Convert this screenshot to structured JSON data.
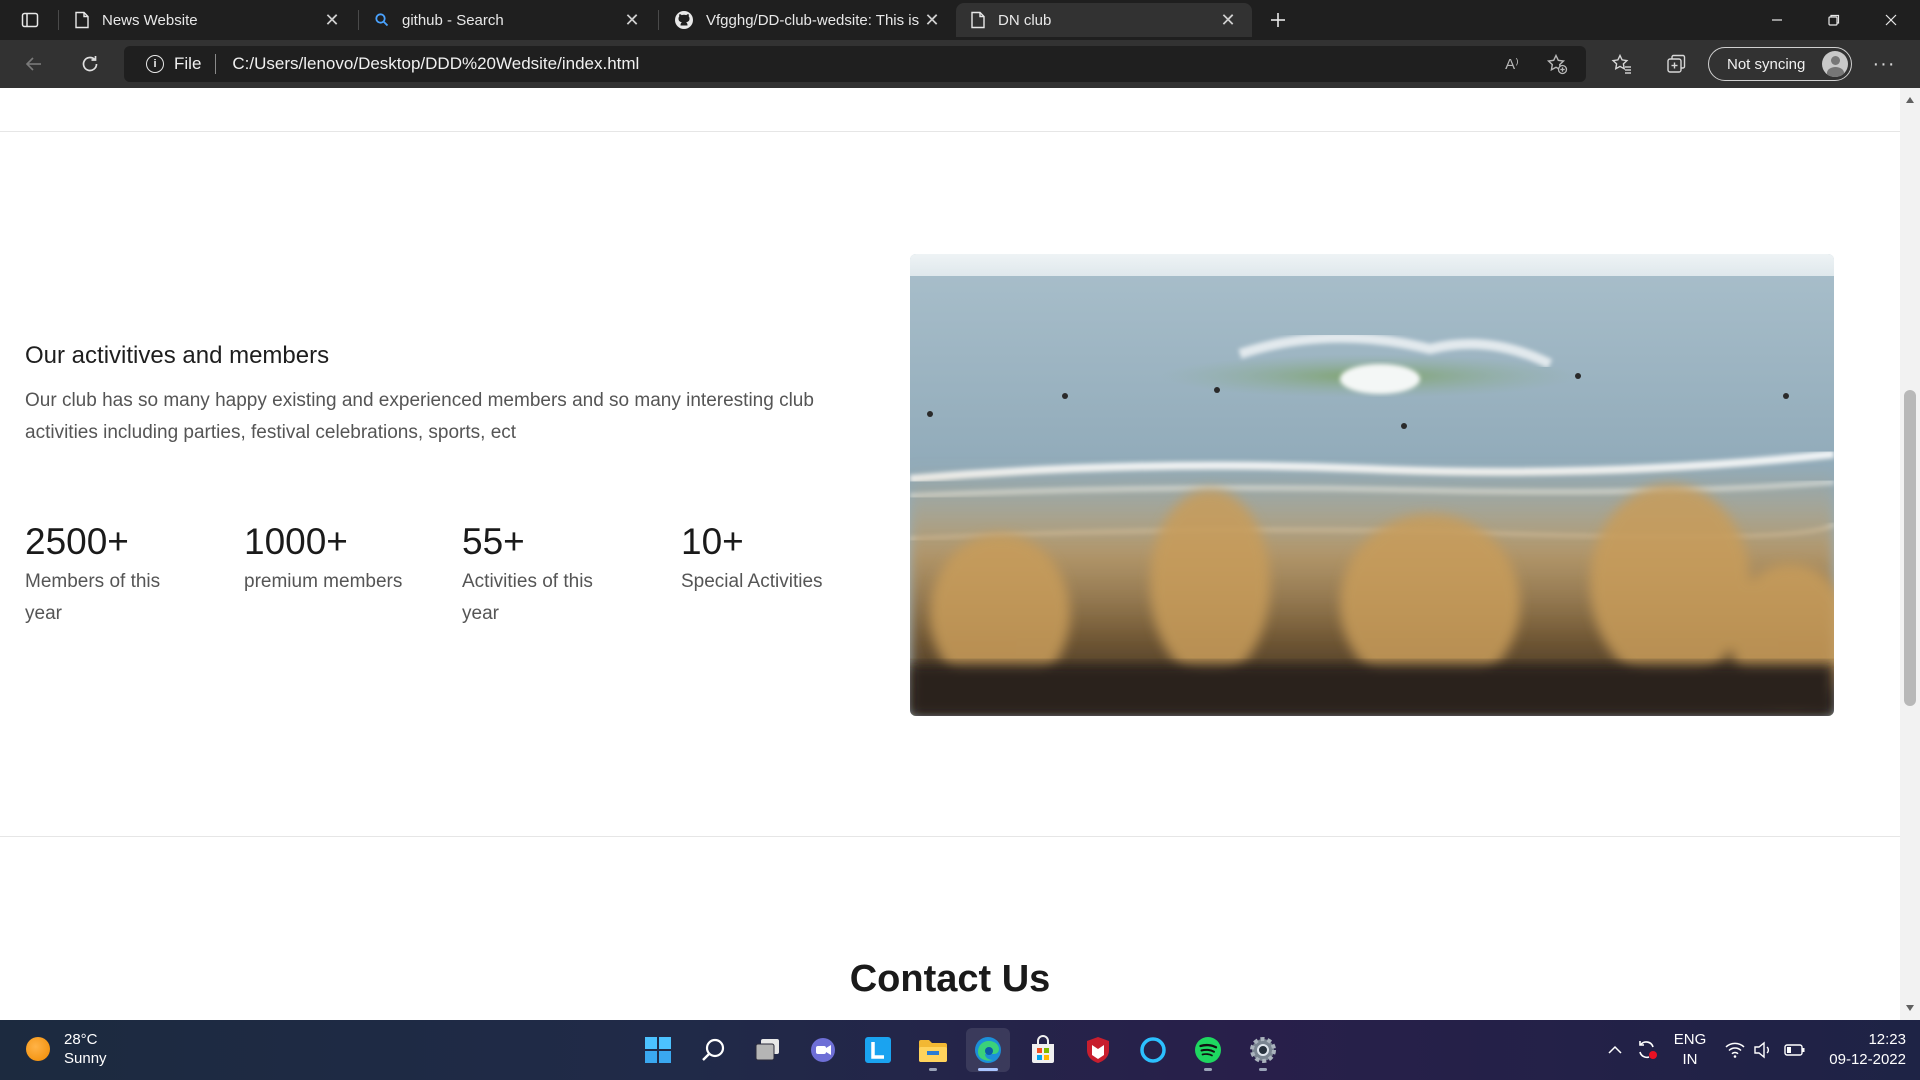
{
  "browser": {
    "tabs": [
      {
        "title": "News Website",
        "icon": "page-icon",
        "active": false
      },
      {
        "title": "github - Search",
        "icon": "search-icon",
        "active": false
      },
      {
        "title": "Vfgghg/DD-club-wedsite: This is",
        "icon": "github-icon",
        "active": false
      },
      {
        "title": "DN club",
        "icon": "page-icon",
        "active": true
      }
    ],
    "address": {
      "scheme": "File",
      "url": "C:/Users/lenovo/Desktop/DDD%20Wedsite/index.html"
    },
    "sync_label": "Not syncing",
    "read_aloud_glyph": "A⁾"
  },
  "page": {
    "about": {
      "title": "Our activitives and members",
      "text": "Our club has so many happy existing and experienced members and so many interesting club activities including parties, festival celebrations, sports, ect"
    },
    "stats": [
      {
        "value": "2500+",
        "label": "Members of this year"
      },
      {
        "value": "1000+",
        "label": "premium members"
      },
      {
        "value": "55+",
        "label": "Activities of this year"
      },
      {
        "value": "10+",
        "label": "Special Activities"
      }
    ],
    "image": {
      "subject": "surf-wave-beach-photo"
    },
    "contact_heading": "Contact Us"
  },
  "taskbar": {
    "weather": {
      "temp": "28°C",
      "condition": "Sunny"
    },
    "apps": [
      "windows-start-icon",
      "search-icon",
      "task-view-icon",
      "teams-chat-icon",
      "l-app-icon",
      "file-explorer-icon",
      "edge-icon",
      "microsoft-store-icon",
      "mcafee-icon",
      "cortana-icon",
      "spotify-icon",
      "settings-icon"
    ],
    "tray": {
      "language": "ENG",
      "region": "IN",
      "time": "12:23",
      "date": "09-12-2022"
    }
  },
  "colors": {
    "chrome_dark": "#1f1f1f",
    "toolbar": "#323232",
    "page_bg": "#ffffff",
    "text_muted": "#555555"
  }
}
